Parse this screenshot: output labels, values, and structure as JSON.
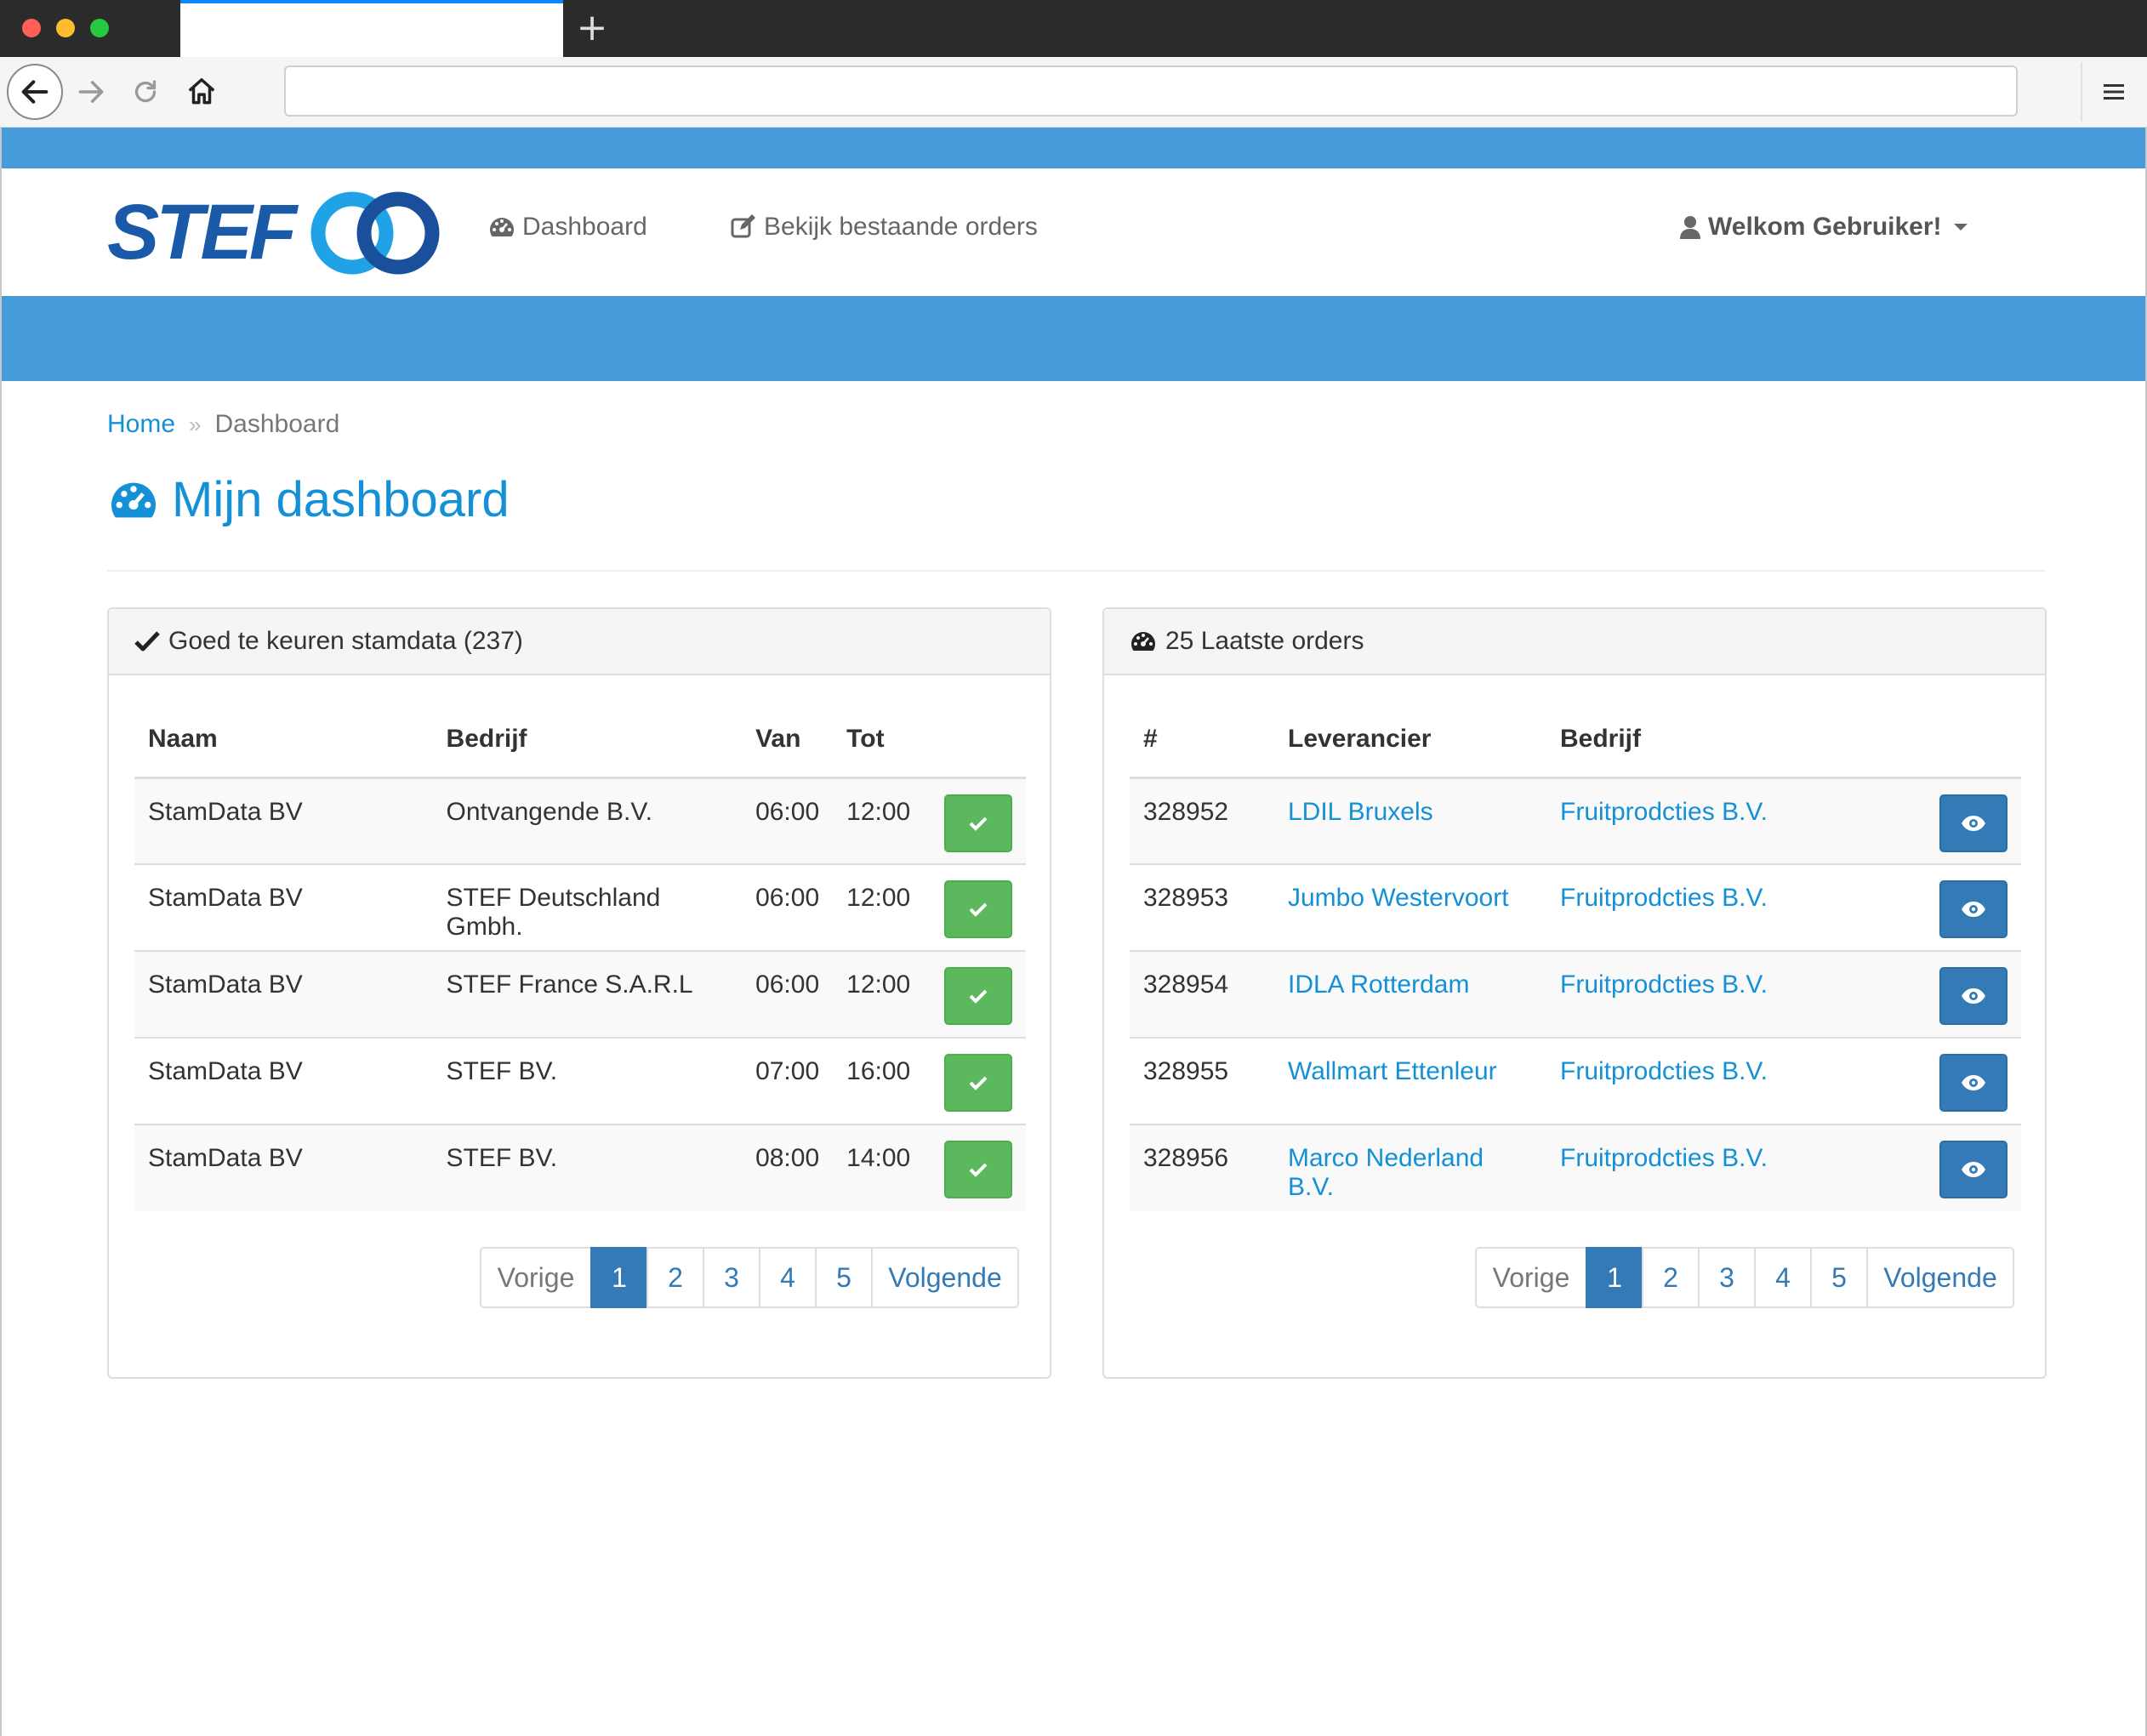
{
  "browser": {
    "new_tab_glyph": "+",
    "url": ""
  },
  "navbar": {
    "logo_text": "STEF",
    "links": [
      {
        "label": "Dashboard",
        "icon": "dashboard-icon"
      },
      {
        "label": "Bekijk bestaande orders",
        "icon": "edit-icon"
      }
    ],
    "user_label": "Welkom Gebruiker!"
  },
  "breadcrumb": {
    "home": "Home",
    "separator": "»",
    "current": "Dashboard"
  },
  "page_title": "Mijn dashboard",
  "stamdata_panel": {
    "title": "Goed te keuren stamdata (237)",
    "columns": [
      "Naam",
      "Bedrijf",
      "Van",
      "Tot"
    ],
    "rows": [
      {
        "naam": "StamData BV",
        "bedrijf": "Ontvangende B.V.",
        "van": "06:00",
        "tot": "12:00"
      },
      {
        "naam": "StamData BV",
        "bedrijf": "STEF Deutschland Gmbh.",
        "van": "06:00",
        "tot": "12:00"
      },
      {
        "naam": "StamData BV",
        "bedrijf": "STEF France S.A.R.L",
        "van": "06:00",
        "tot": "12:00"
      },
      {
        "naam": "StamData BV",
        "bedrijf": "STEF BV.",
        "van": "07:00",
        "tot": "16:00"
      },
      {
        "naam": "StamData BV",
        "bedrijf": "STEF BV.",
        "van": "08:00",
        "tot": "14:00"
      }
    ],
    "pagination": {
      "prev": "Vorige",
      "pages": [
        "1",
        "2",
        "3",
        "4",
        "5"
      ],
      "active": "1",
      "next": "Volgende"
    }
  },
  "orders_panel": {
    "title": "25 Laatste orders",
    "columns": [
      "#",
      "Leverancier",
      "Bedrijf"
    ],
    "rows": [
      {
        "id": "328952",
        "leverancier": "LDIL Bruxels",
        "bedrijf": "Fruitprodcties B.V."
      },
      {
        "id": "328953",
        "leverancier": "Jumbo Westervoort",
        "bedrijf": "Fruitprodcties B.V."
      },
      {
        "id": "328954",
        "leverancier": "IDLA Rotterdam",
        "bedrijf": "Fruitprodcties B.V."
      },
      {
        "id": "328955",
        "leverancier": "Wallmart Ettenleur",
        "bedrijf": "Fruitprodcties B.V."
      },
      {
        "id": "328956",
        "leverancier": "Marco Nederland B.V.",
        "bedrijf": "Fruitprodcties B.V."
      }
    ],
    "pagination": {
      "prev": "Vorige",
      "pages": [
        "1",
        "2",
        "3",
        "4",
        "5"
      ],
      "active": "1",
      "next": "Volgende"
    }
  },
  "colors": {
    "brand_blue": "#1390d6",
    "bar_blue": "#469cda",
    "approve_green": "#5cb85c",
    "view_blue": "#337ab7"
  }
}
